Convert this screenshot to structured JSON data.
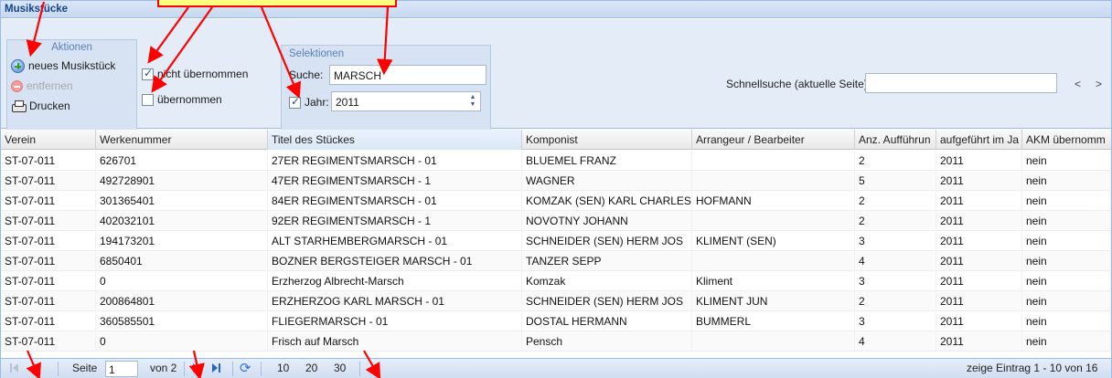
{
  "panel": {
    "title": "Musikstücke"
  },
  "actions": {
    "title": "Aktionen",
    "new_label": "neues Musikstück",
    "remove_label": "entfernen",
    "print_label": "Drucken"
  },
  "filters": {
    "not_taken_label": "nicht übernommen",
    "taken_label": "übernommen",
    "not_taken_checked": true,
    "taken_checked": false
  },
  "selection": {
    "title": "Selektionen",
    "search_label": "Suche:",
    "search_value": "MARSCH",
    "year_label": "Jahr:",
    "year_value": "2011",
    "year_checked": true
  },
  "quicksearch": {
    "label": "Schnellsuche (aktuelle Seite)",
    "value": "",
    "prev": "<",
    "next": ">"
  },
  "grid": {
    "columns": [
      "Verein",
      "Werkenummer",
      "Titel des Stückes",
      "Komponist",
      "Arrangeur / Bearbeiter",
      "Anz. Aufführun",
      "aufgeführt im Ja",
      "AKM übernomm"
    ],
    "rows": [
      [
        "ST-07-011",
        "626701",
        "27ER REGIMENTSMARSCH - 01",
        "BLUEMEL FRANZ",
        "",
        "2",
        "2011",
        "nein"
      ],
      [
        "ST-07-011",
        "492728901",
        "47ER REGIMENTSMARSCH - 1",
        "WAGNER",
        "",
        "5",
        "2011",
        "nein"
      ],
      [
        "ST-07-011",
        "301365401",
        "84ER REGIMENTSMARSCH - 01",
        "KOMZAK (SEN) KARL CHARLES",
        "HOFMANN",
        "2",
        "2011",
        "nein"
      ],
      [
        "ST-07-011",
        "402032101",
        "92ER REGIMENTSMARSCH - 1",
        "NOVOTNY JOHANN",
        "",
        "2",
        "2011",
        "nein"
      ],
      [
        "ST-07-011",
        "194173201",
        "ALT STARHEMBERGMARSCH - 01",
        "SCHNEIDER (SEN) HERM JOS",
        "KLIMENT (SEN)",
        "3",
        "2011",
        "nein"
      ],
      [
        "ST-07-011",
        "6850401",
        "BOZNER BERGSTEIGER MARSCH - 01",
        "TANZER SEPP",
        "",
        "4",
        "2011",
        "nein"
      ],
      [
        "ST-07-011",
        "0",
        "Erzherzog Albrecht-Marsch",
        "Komzak",
        "Kliment",
        "3",
        "2011",
        "nein"
      ],
      [
        "ST-07-011",
        "200864801",
        "ERZHERZOG KARL MARSCH - 01",
        "SCHNEIDER (SEN) HERM JOS",
        "KLIMENT JUN",
        "2",
        "2011",
        "nein"
      ],
      [
        "ST-07-011",
        "360585501",
        "FLIEGERMARSCH - 01",
        "DOSTAL HERMANN",
        "BUMMERL",
        "3",
        "2011",
        "nein"
      ],
      [
        "ST-07-011",
        "0",
        "Frisch auf Marsch",
        "Pensch",
        "",
        "4",
        "2011",
        "nein"
      ]
    ]
  },
  "pager": {
    "page_label": "Seite",
    "page_value": "1",
    "of_label": "von 2",
    "size_10": "10",
    "size_20": "20",
    "size_30": "30",
    "status": "zeige Eintrag 1 - 10 von 16"
  },
  "overlay": {
    "callout_color": "#ffff80",
    "arrow_color": "#ff0000"
  }
}
